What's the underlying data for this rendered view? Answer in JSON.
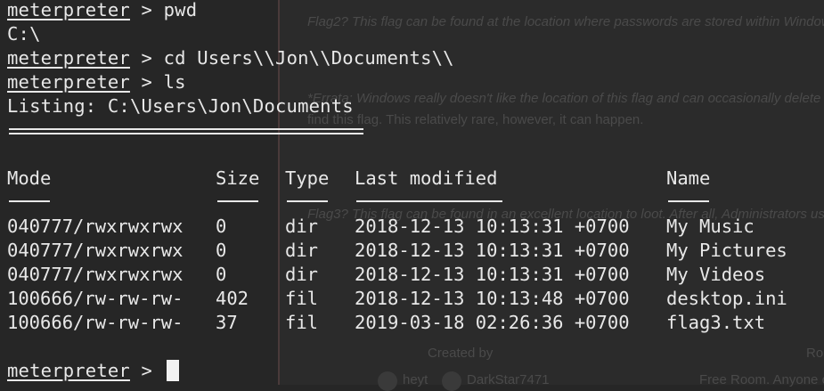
{
  "background_page": {
    "flag2": "Flag2? This flag can be found at the location where passwords are stored within Windows",
    "errata_1": "*Errata: Windows really doesn't like the location of this flag and can occasionally delete",
    "errata_2": "find this flag. This relatively rare, however, it can happen.",
    "flag3": "Flag3? This flag can be found in an excellent location to loot. After all, Administrators usua",
    "created_by": "Created by",
    "room_col": "Ro",
    "author_1": "heyt",
    "author_2": "DarkStar7471",
    "free_room": "Free Room. Anyone c"
  },
  "terminal": {
    "prompt": "meterpreter",
    "sep": " > ",
    "lines": [
      {
        "type": "cmd",
        "text": "pwd"
      },
      {
        "type": "out",
        "text": "C:\\"
      },
      {
        "type": "cmd",
        "text": "cd Users\\\\Jon\\\\Documents\\\\"
      },
      {
        "type": "cmd",
        "text": "ls"
      },
      {
        "type": "out",
        "text": "Listing: C:\\Users\\Jon\\Documents"
      }
    ],
    "table": {
      "headers": [
        "Mode",
        "Size",
        "Type",
        "Last modified",
        "Name"
      ],
      "rows": [
        [
          "040777/rwxrwxrwx",
          "0",
          "dir",
          "2018-12-13 10:13:31 +0700",
          "My Music"
        ],
        [
          "040777/rwxrwxrwx",
          "0",
          "dir",
          "2018-12-13 10:13:31 +0700",
          "My Pictures"
        ],
        [
          "040777/rwxrwxrwx",
          "0",
          "dir",
          "2018-12-13 10:13:31 +0700",
          "My Videos"
        ],
        [
          "100666/rw-rw-rw-",
          "402",
          "fil",
          "2018-12-13 10:13:48 +0700",
          "desktop.ini"
        ],
        [
          "100666/rw-rw-rw-",
          "37",
          "fil",
          "2019-03-18 02:26:36 +0700",
          "flag3.txt"
        ]
      ]
    }
  }
}
